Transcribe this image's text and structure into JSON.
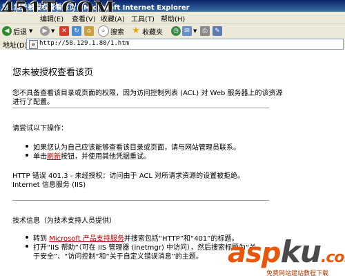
{
  "window": {
    "title": "您未被授权查看该页 - Microsoft Internet Explorer"
  },
  "watermark": {
    "text": "451T.COM"
  },
  "menu": {
    "items": [
      "编辑(E)",
      "查看(V)",
      "收藏(A)",
      "工具(T)",
      "帮助(H)"
    ]
  },
  "toolbar": {
    "back_label": "后退",
    "search_label": "搜索",
    "favorites_label": "收藏夹"
  },
  "address": {
    "label": "地址(D)",
    "url": "http://58.129.1.80/1.htm"
  },
  "page": {
    "heading": "您未被授权查看该页",
    "intro_line1": "您不具备查看该目录或页面的权限，因为访问控制列表 (ACL) 对 Web 服务器上的该资源",
    "intro_line2": "进行了配置。",
    "try_heading": "请尝试以下操作：",
    "try_items": [
      "如果您认为自己应该能够查看该目录或页面，请与网站管理员联系。",
      {
        "pre": "单击",
        "link": "刷新",
        "post": "按钮，并使用其他凭据重试。"
      }
    ],
    "error_line": "HTTP 错误 401.3 - 未经授权：访问由于 ACL 对所请求资源的设置被拒绝。",
    "server_line": "Internet 信息服务 (IIS)",
    "tech_heading": "技术信息（为技术支持人员提供）",
    "tech_items": [
      {
        "pre": "转到 ",
        "link": "Microsoft 产品支持服务",
        "post": "并搜索包括“HTTP”和“401”的标题。"
      },
      {
        "line1": "打开“IIS 帮助”（可在 IIS 管理器 (inetmgr) 中访问），然后搜索标题为“关",
        "line2": "于安全”、“访问控制”和“关于自定义错误消息”的主题。"
      }
    ]
  },
  "logo": {
    "text_a": "asp",
    "text_b": "ku",
    "text_c": ".com",
    "subtitle": "免费网站建站教程下载"
  }
}
